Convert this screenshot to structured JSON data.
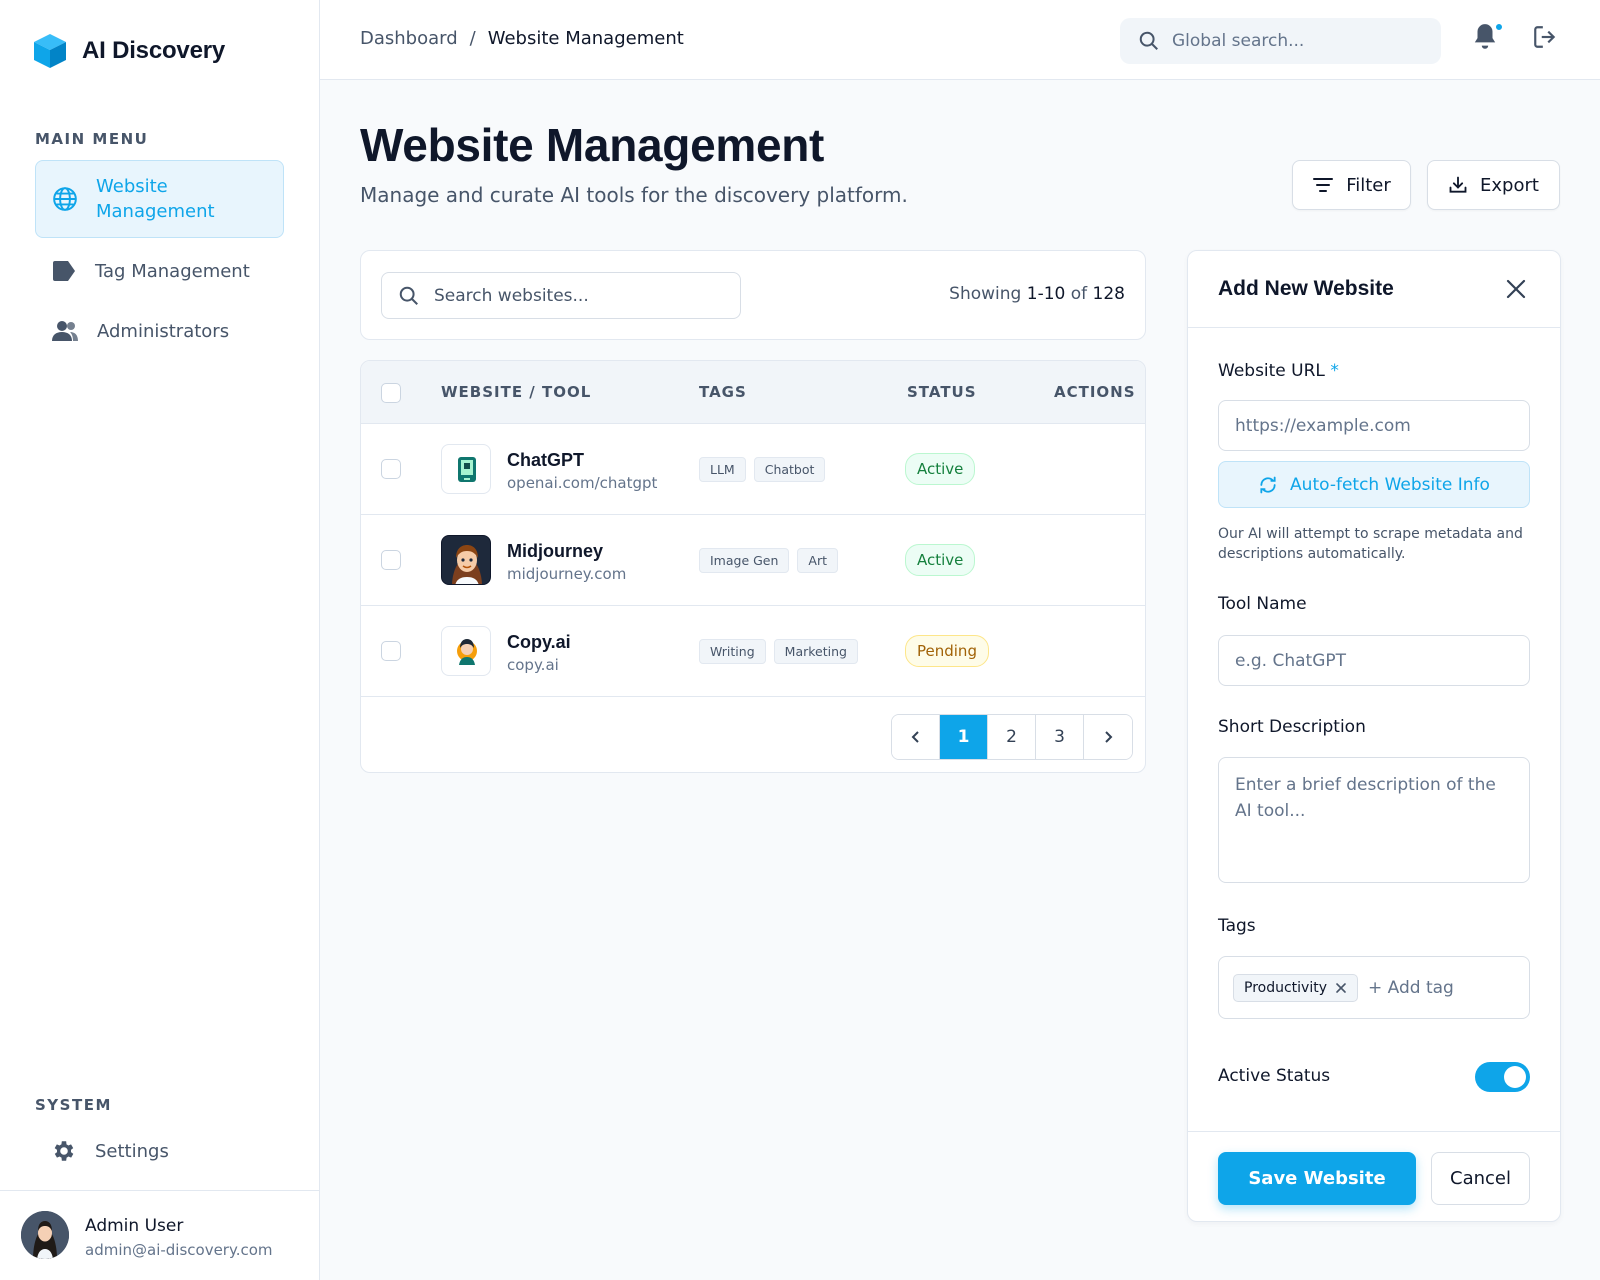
{
  "brand": {
    "name": "AI Discovery",
    "icon": "cube-icon"
  },
  "sidebar": {
    "main_menu_label": "MAIN MENU",
    "items": [
      {
        "label": "Website Management",
        "icon": "globe-icon",
        "active": true
      },
      {
        "label": "Tag Management",
        "icon": "tag-icon",
        "active": false
      },
      {
        "label": "Administrators",
        "icon": "users-icon",
        "active": false
      }
    ],
    "system_label": "SYSTEM",
    "settings_label": "Settings"
  },
  "user": {
    "name": "Admin User",
    "email": "admin@ai-discovery.com"
  },
  "header": {
    "breadcrumb": [
      "Dashboard",
      "Website Management"
    ],
    "breadcrumb_sep": "/",
    "search_placeholder": "Global search..."
  },
  "page": {
    "title": "Website Management",
    "subtitle": "Manage and curate AI tools for the discovery platform.",
    "filter_label": "Filter",
    "export_label": "Export"
  },
  "list": {
    "search_placeholder": "Search websites...",
    "showing_prefix": "Showing",
    "showing_range": "1-10",
    "showing_of": "of",
    "showing_total": "128",
    "columns": [
      "WEBSITE / TOOL",
      "TAGS",
      "STATUS",
      "ACTIONS"
    ],
    "rows": [
      {
        "name": "ChatGPT",
        "url": "openai.com/chatgpt",
        "tags": [
          "LLM",
          "Chatbot"
        ],
        "status": "Active"
      },
      {
        "name": "Midjourney",
        "url": "midjourney.com",
        "tags": [
          "Image Gen",
          "Art"
        ],
        "status": "Active"
      },
      {
        "name": "Copy.ai",
        "url": "copy.ai",
        "tags": [
          "Writing",
          "Marketing"
        ],
        "status": "Pending"
      }
    ],
    "pagination": {
      "pages": [
        "1",
        "2",
        "3"
      ],
      "current": "1"
    }
  },
  "form": {
    "title": "Add New Website",
    "url_label": "Website URL",
    "url_required": "*",
    "url_placeholder": "https://example.com",
    "autofetch_label": "Auto-fetch Website Info",
    "autofetch_help": "Our AI will attempt to scrape metadata and descriptions automatically.",
    "name_label": "Tool Name",
    "name_placeholder": "e.g. ChatGPT",
    "desc_label": "Short Description",
    "desc_placeholder": "Enter a brief description of the AI tool...",
    "tags_label": "Tags",
    "tags": [
      "Productivity"
    ],
    "add_tag_placeholder": "+ Add tag",
    "status_label": "Active Status",
    "status_on": true,
    "save_label": "Save Website",
    "cancel_label": "Cancel"
  },
  "colors": {
    "accent": "#0ea5e9",
    "text": "#0f172a",
    "muted": "#475569",
    "border": "#e2e8f0"
  }
}
